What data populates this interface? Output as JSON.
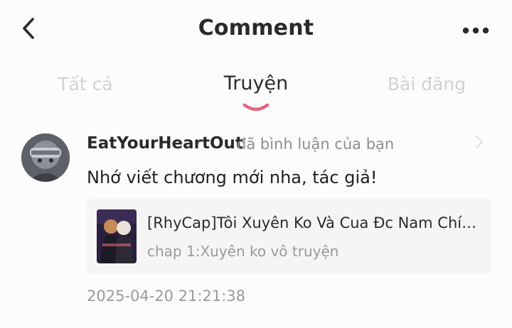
{
  "header": {
    "title": "Comment",
    "back_icon": "chevron-left-icon",
    "more_icon": "more-dots-icon"
  },
  "tabs": [
    {
      "label": "Tất cả",
      "active": false
    },
    {
      "label": "Truyện",
      "active": true
    },
    {
      "label": "Bài đăng",
      "active": false
    }
  ],
  "accent_color": "#e8637a",
  "notification": {
    "username": "EatYourHeartOut",
    "action": "đã bình luận của bạn",
    "comment": "Nhớ viết chương mới nha, tác giả!",
    "story": {
      "title": "[RhyCap]Tôi Xuyên Ko Và Cua Đc Nam Chính Bi Thảm",
      "chapter": "chap 1:Xuyên ko vô truyện"
    },
    "timestamp": "2025-04-20 21:21:38"
  }
}
